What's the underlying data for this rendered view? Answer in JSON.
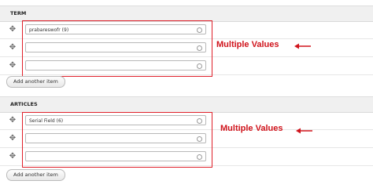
{
  "sections": [
    {
      "header": "TERM",
      "rows": [
        {
          "value": "prabareswofr (9)"
        },
        {
          "value": ""
        },
        {
          "value": ""
        }
      ],
      "add_button": "Add another item",
      "annotation": "Multiple Values"
    },
    {
      "header": "ARTICLES",
      "rows": [
        {
          "value": "Serial Field (6)"
        },
        {
          "value": ""
        },
        {
          "value": ""
        }
      ],
      "add_button": "Add another item",
      "annotation": "Multiple Values"
    }
  ],
  "colors": {
    "annotation": "#d0141c",
    "header_bg": "#f0f0f0"
  },
  "icons": {
    "drag_handle": "move-icon",
    "autocomplete": "autocomplete-throbber-icon"
  }
}
